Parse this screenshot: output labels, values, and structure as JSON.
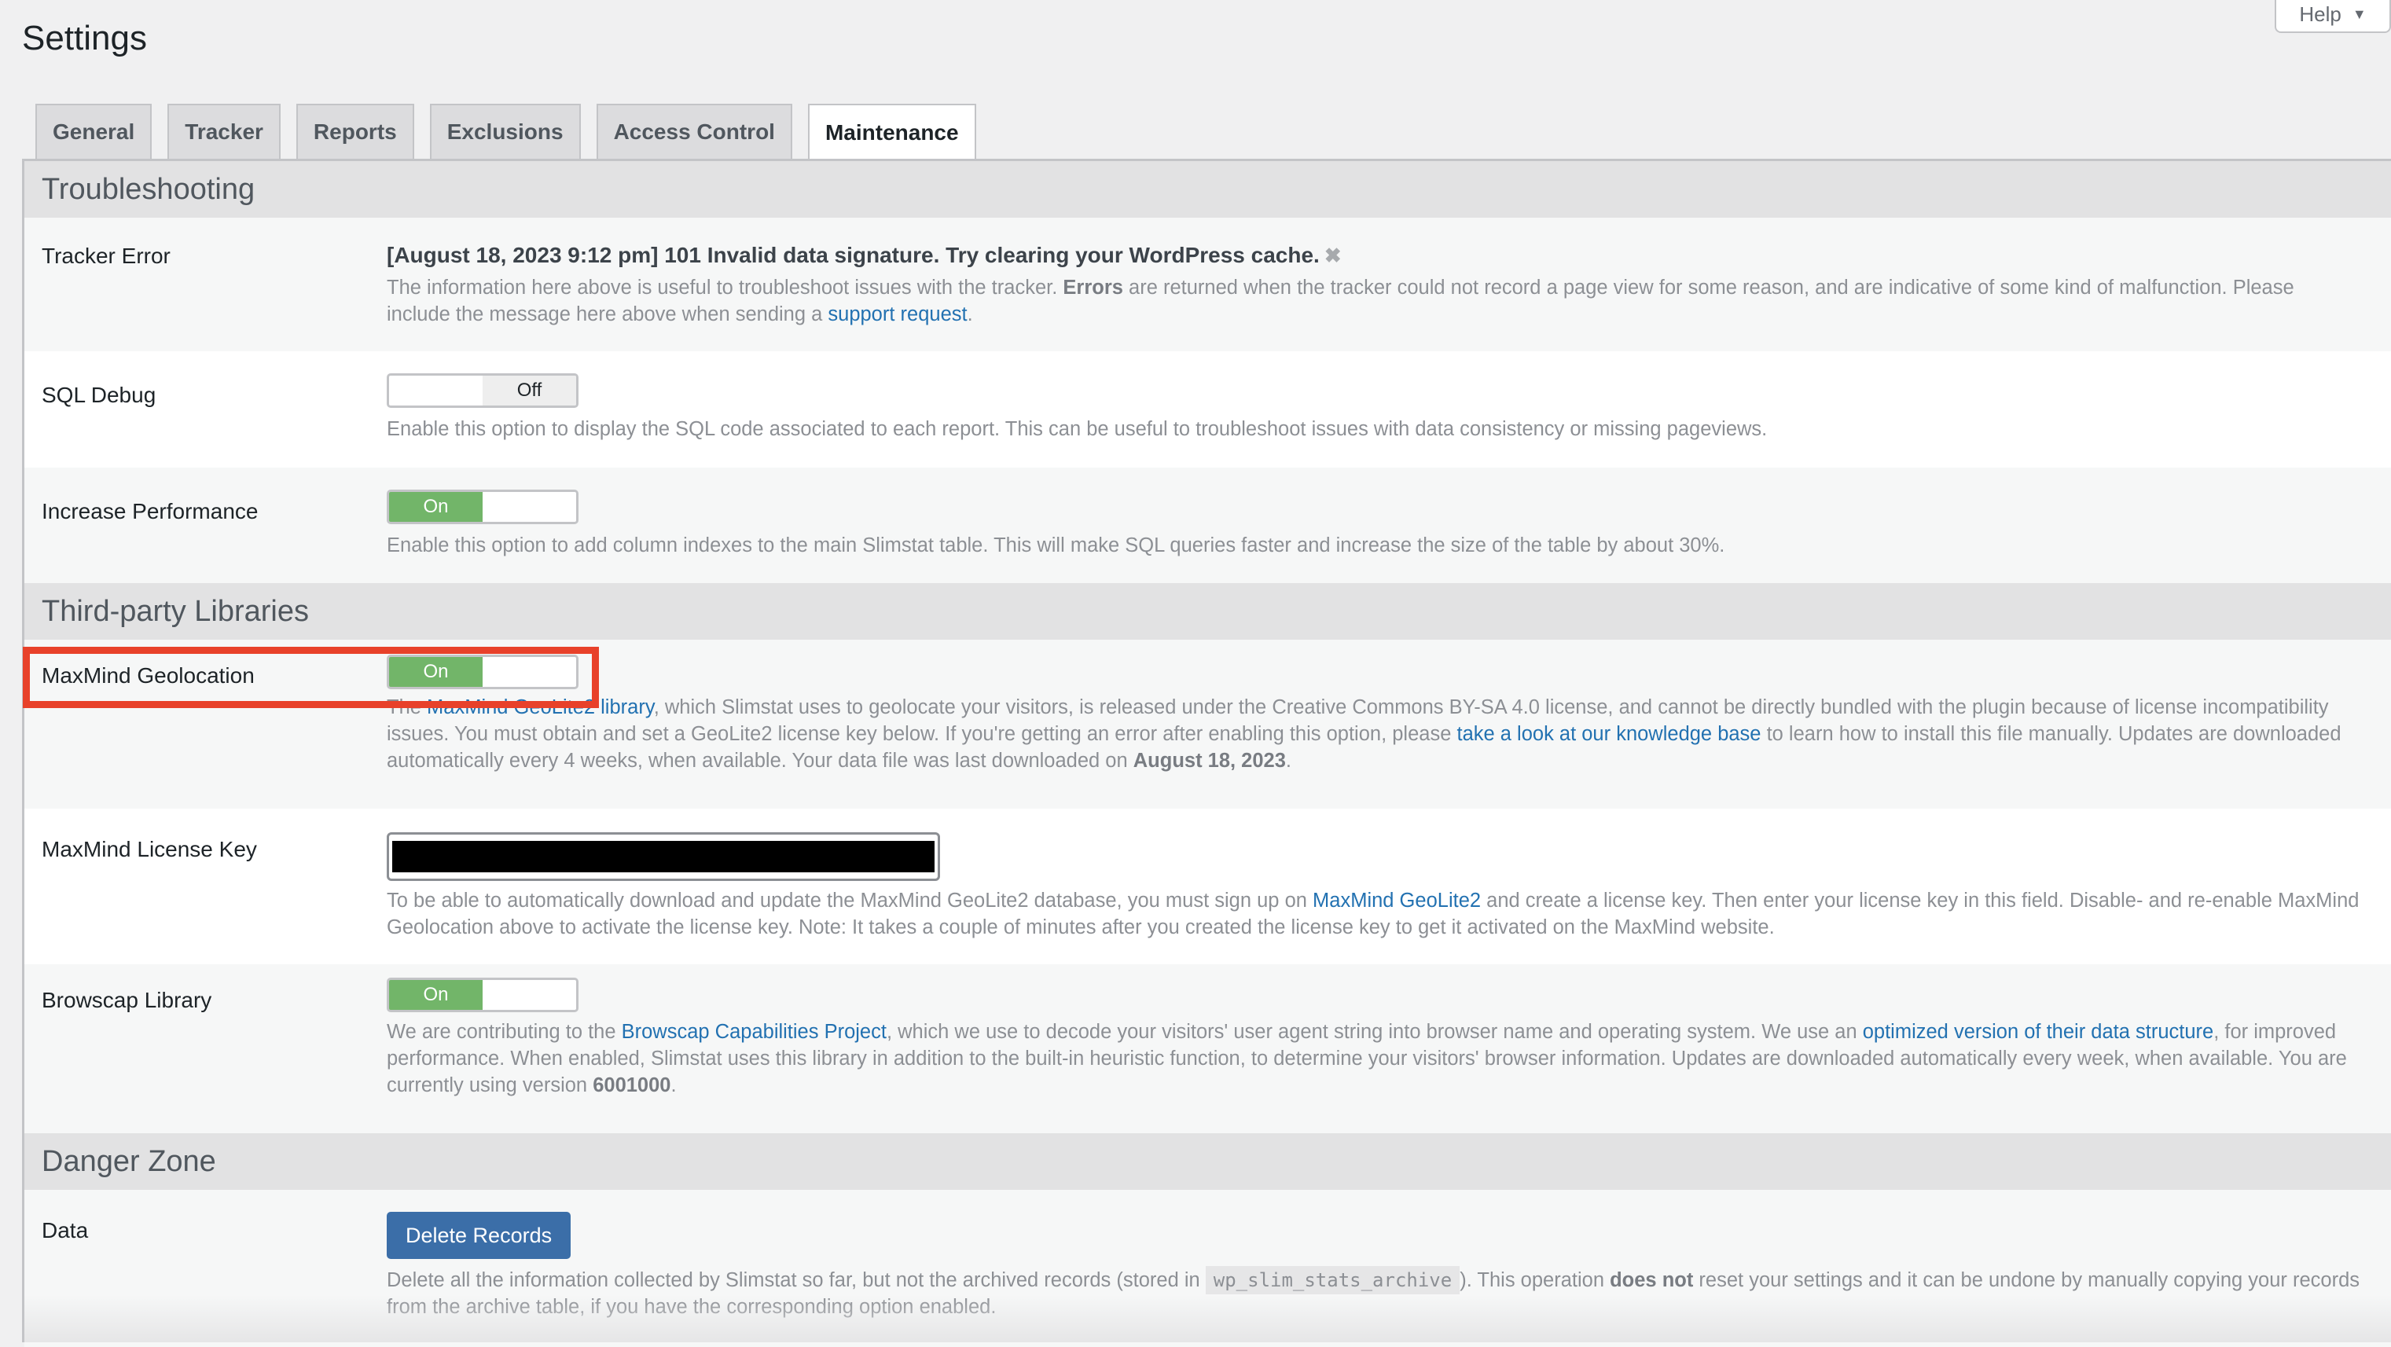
{
  "header": {
    "title": "Settings",
    "help_label": "Help",
    "help_icon": "triangle-down"
  },
  "tabs": [
    {
      "label": "General",
      "active": false
    },
    {
      "label": "Tracker",
      "active": false
    },
    {
      "label": "Reports",
      "active": false
    },
    {
      "label": "Exclusions",
      "active": false
    },
    {
      "label": "Access Control",
      "active": false
    },
    {
      "label": "Maintenance",
      "active": true
    }
  ],
  "sections": {
    "troubleshooting": {
      "title": "Troubleshooting",
      "tracker_error": {
        "label": "Tracker Error",
        "message": "[August 18, 2023 9:12 pm] 101 Invalid data signature. Try clearing your WordPress cache.",
        "dismiss_icon": "close-x",
        "desc_1": "The information here above is useful to troubleshoot issues with the tracker. ",
        "desc_bold": "Errors",
        "desc_2": " are returned when the tracker could not record a page view for some reason, and are indicative of some kind of malfunction. Please include the message here above when sending a ",
        "desc_link": "support request",
        "desc_3": "."
      },
      "sql_debug": {
        "label": "SQL Debug",
        "state": "Off",
        "desc": "Enable this option to display the SQL code associated to each report. This can be useful to troubleshoot issues with data consistency or missing pageviews."
      },
      "increase_performance": {
        "label": "Increase Performance",
        "state": "On",
        "desc": "Enable this option to add column indexes to the main Slimstat table. This will make SQL queries faster and increase the size of the table by about 30%."
      }
    },
    "third_party": {
      "title": "Third-party Libraries",
      "maxmind_geolocation": {
        "label": "MaxMind Geolocation",
        "state": "On",
        "highlighted": true,
        "desc_1": "The ",
        "desc_link_1": "MaxMind GeoLite2 library",
        "desc_2": ", which Slimstat uses to geolocate your visitors, is released under the Creative Commons BY-SA 4.0 license, and cannot be directly bundled with the plugin because of license incompatibility issues. You must obtain and set a GeoLite2 license key below. If you're getting an error after enabling this option, please ",
        "desc_link_2": "take a look at our knowledge base",
        "desc_3": " to learn how to install this file manually. Updates are downloaded automatically every 4 weeks, when available. Your data file was last downloaded on ",
        "desc_bold": "August 18, 2023",
        "desc_4": "."
      },
      "maxmind_license_key": {
        "label": "MaxMind License Key",
        "value_redacted": true,
        "desc_1": "To be able to automatically download and update the MaxMind GeoLite2 database, you must sign up on ",
        "desc_link": "MaxMind GeoLite2",
        "desc_2": " and create a license key. Then enter your license key in this field. Disable- and re-enable MaxMind Geolocation above to activate the license key. Note: It takes a couple of minutes after you created the license key to get it activated on the MaxMind website."
      },
      "browscap": {
        "label": "Browscap Library",
        "state": "On",
        "desc_1": "We are contributing to the ",
        "desc_link_1": "Browscap Capabilities Project",
        "desc_2": ", which we use to decode your visitors' user agent string into browser name and operating system. We use an ",
        "desc_link_2": "optimized version of their data structure",
        "desc_3": ", for improved performance. When enabled, Slimstat uses this library in addition to the built-in heuristic function, to determine your visitors' browser information. Updates are downloaded automatically every week, when available. You are currently using version ",
        "desc_bold": "6001000",
        "desc_4": "."
      }
    },
    "danger_zone": {
      "title": "Danger Zone",
      "data": {
        "label": "Data",
        "button_label": "Delete Records",
        "desc_1": "Delete all the information collected by Slimstat so far, but not the archived records (stored in ",
        "desc_code": "wp_slim_stats_archive",
        "desc_2": "). This operation ",
        "desc_bold": "does not",
        "desc_3": " reset your settings and it can be undone by manually copying your records from the archive table, if you have the corresponding option enabled."
      }
    }
  },
  "colors": {
    "toggle_on": "#72b569",
    "link": "#2271b1",
    "primary_button": "#3b6ea8",
    "highlight_box": "#e8412a"
  }
}
